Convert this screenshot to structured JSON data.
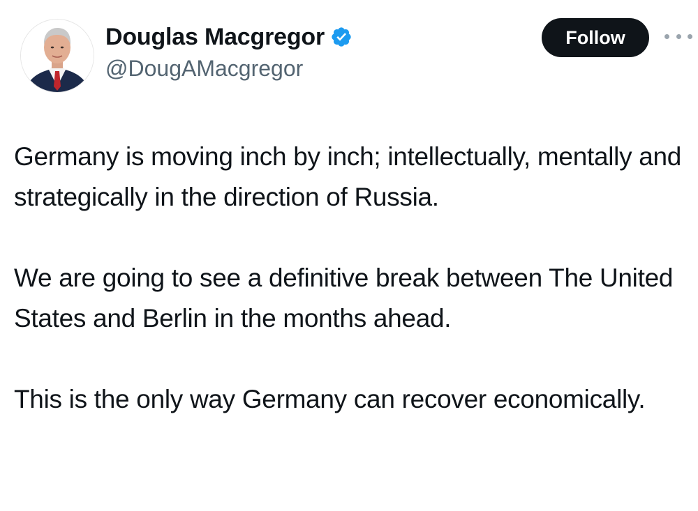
{
  "author": {
    "display_name": "Douglas Macgregor",
    "handle": "@DougAMacgregor",
    "verified": true,
    "avatar_icon": "profile-photo",
    "verified_icon": "verified-badge-icon"
  },
  "actions": {
    "follow_label": "Follow",
    "more_icon": "more-options-icon"
  },
  "tweet": {
    "paragraphs": [
      "Germany is moving inch by inch; intellectually, mentally and strategically in the direction of Russia.",
      "We are going to see a definitive break between The United States and Berlin in the months ahead.",
      "This is the only way Germany can recover economically."
    ]
  },
  "colors": {
    "text": "#0f1419",
    "secondary_text": "#536471",
    "follow_bg": "#0f1419",
    "verified_blue": "#1d9bf0"
  }
}
